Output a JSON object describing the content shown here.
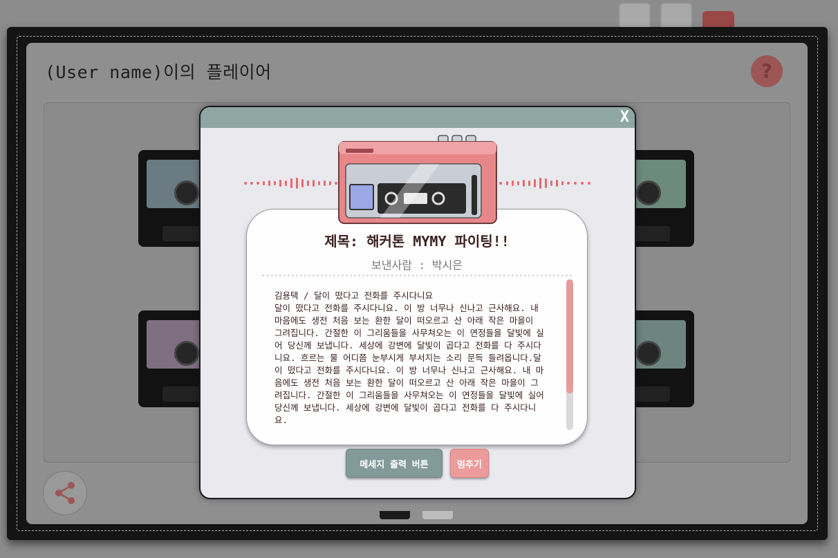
{
  "player": {
    "title": "(User name)이의 플레이어",
    "help_icon": "question-mark-icon",
    "share_icon": "share-icon"
  },
  "colors": {
    "modal_header": "#8ea7a3",
    "accent_pink": "#ec9b9b",
    "walkman_pink": "#e8868a",
    "print_button": "#829a98"
  },
  "modal": {
    "close_label": "X",
    "message_title": "제목: 해커톤 MYMY 파이팅!!",
    "sender_line": "보낸사람 : 박시은",
    "message_body": "김용택 / 달이 떴다고 전화를 주시다니요\n달이 떴다고 전화를 주시다니요. 이 방 너무나 신나고 근사해요. 내 마음에도 생전 처음 보는 환한 달이 떠오르고 산 아래 작은 마을이 그려집니다. 간절한 이 그리움들을 사무쳐오는 이 연정들을 달빛에 실어 당신께 보냅니다. 세상에 강변에 달빛이 곱다고 전화를 다 주시다니요. 흐르는 물 어디쯤 눈부시게 부서지는 소리 문득 들려옵니다.달이 떴다고 전화를 주시다니요. 이 방 너무나 신나고 근사해요. 내 마음에도 생전 처음 보는 환한 달이 떠오르고 산 아래 작은 마을이 그려집니다. 간절한 이 그리움들을 사무쳐오는 이 연정들을 달빛에 실어 당신께 보냅니다. 세상에 강변에 달빛이 곱다고 전화를 다 주시다니요.",
    "print_button_label": "메세지 출력 버튼",
    "stop_button_label": "멈추기",
    "scroll_position": 0.0
  }
}
